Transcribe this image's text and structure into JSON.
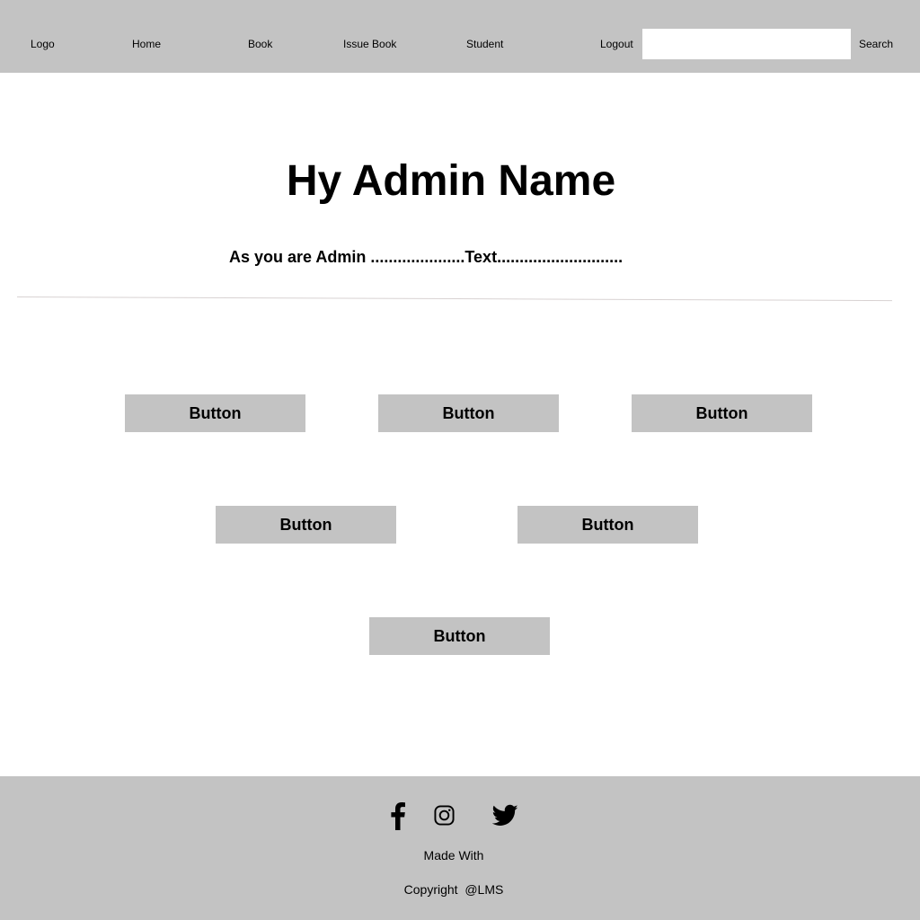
{
  "nav": {
    "logo": "Logo",
    "home": "Home",
    "book": "Book",
    "issue_book": "Issue Book",
    "student": "Student",
    "logout": "Logout",
    "search_value": "",
    "search_label": "Search"
  },
  "main": {
    "title": "Hy Admin Name",
    "subtitle": "As you are Admin .....................Text............................",
    "buttons": [
      "Button",
      "Button",
      "Button",
      "Button",
      "Button",
      "Button"
    ]
  },
  "footer": {
    "icons": [
      "facebook-icon",
      "instagram-icon",
      "twitter-icon"
    ],
    "made_with": "Made With",
    "copyright": "Copyright  @LMS"
  },
  "colors": {
    "bar_gray": "#c3c3c3",
    "background": "#ffffff",
    "text": "#000000"
  }
}
